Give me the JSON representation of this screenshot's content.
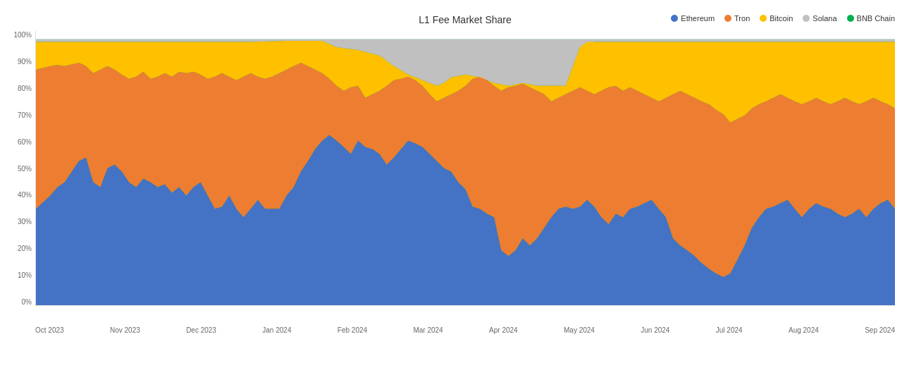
{
  "chart": {
    "title": "L1 Fee Market Share",
    "y_labels": [
      "0%",
      "10%",
      "20%",
      "30%",
      "40%",
      "50%",
      "60%",
      "70%",
      "80%",
      "90%",
      "100%"
    ],
    "x_labels": [
      "Oct 2023",
      "Nov 2023",
      "Dec 2023",
      "Jan 2024",
      "Feb 2024",
      "Mar 2024",
      "Apr 2024",
      "May 2024",
      "Jun 2024",
      "Jul 2024",
      "Aug 2024",
      "Sep 2024"
    ],
    "colors": {
      "ethereum": "#4472C4",
      "tron": "#ED7D31",
      "bitcoin": "#FFC000",
      "solana": "#C0C0C0",
      "bnb_chain": "#00B050"
    }
  },
  "legend": {
    "items": [
      {
        "label": "Ethereum",
        "color": "#4472C4"
      },
      {
        "label": "Tron",
        "color": "#ED7D31"
      },
      {
        "label": "Bitcoin",
        "color": "#FFC000"
      },
      {
        "label": "Solana",
        "color": "#C0C0C0"
      },
      {
        "label": "BNB Chain",
        "color": "#00B050"
      }
    ]
  }
}
